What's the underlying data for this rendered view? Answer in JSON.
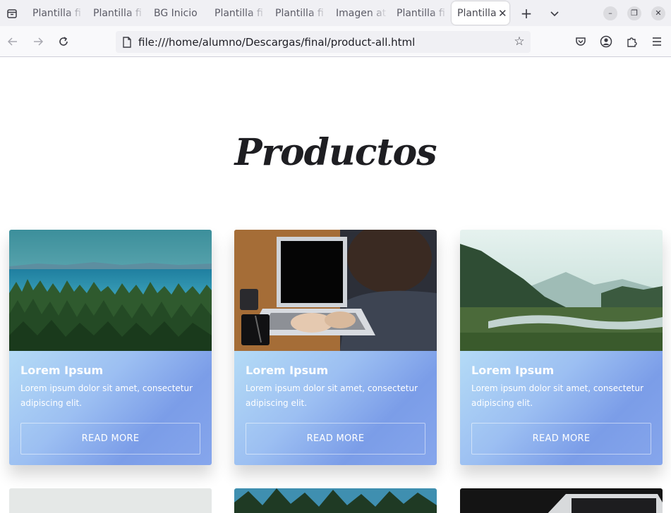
{
  "browser": {
    "tabs": [
      {
        "label": "Plantilla fi"
      },
      {
        "label": "Plantilla fi"
      },
      {
        "label": "BG Inicio"
      },
      {
        "label": "Plantilla fi"
      },
      {
        "label": "Plantilla fi"
      },
      {
        "label": "Imagen at"
      },
      {
        "label": "Plantilla fi"
      },
      {
        "label": "Plantilla"
      }
    ],
    "url": "file:///home/alumno/Descargas/final/product-all.html"
  },
  "page": {
    "title": "Productos",
    "cards": [
      {
        "image": "coastal-forest-photo",
        "title": "Lorem Ipsum",
        "text": "Lorem ipsum dolor sit amet, consectetur adipiscing elit.",
        "button": "READ MORE"
      },
      {
        "image": "laptop-on-desk-photo",
        "title": "Lorem Ipsum",
        "text": "Lorem ipsum dolor sit amet, consectetur adipiscing elit.",
        "button": "READ MORE"
      },
      {
        "image": "misty-valley-river-photo",
        "title": "Lorem Ipsum",
        "text": "Lorem ipsum dolor sit amet, consectetur adipiscing elit.",
        "button": "READ MORE"
      }
    ]
  },
  "colors": {
    "card_gradient_start": "#b4dbf6",
    "card_gradient_end": "#7b9de8",
    "title_color": "#1e1e22"
  }
}
